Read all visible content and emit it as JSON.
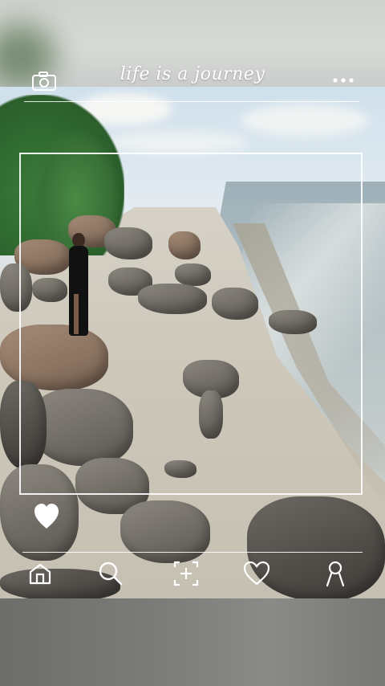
{
  "app": {
    "title": "life is a journey"
  },
  "toolbar": {
    "camera_icon": "camera-icon",
    "more_icon": "more-dots-icon"
  },
  "photo": {
    "like_icon": "heart-filled-icon"
  },
  "nav": {
    "items": [
      {
        "icon": "home-icon"
      },
      {
        "icon": "search-icon"
      },
      {
        "icon": "add-post-icon"
      },
      {
        "icon": "heart-icon"
      },
      {
        "icon": "profile-icon"
      }
    ]
  },
  "colors": {
    "ui_foreground": "#ffffff"
  }
}
